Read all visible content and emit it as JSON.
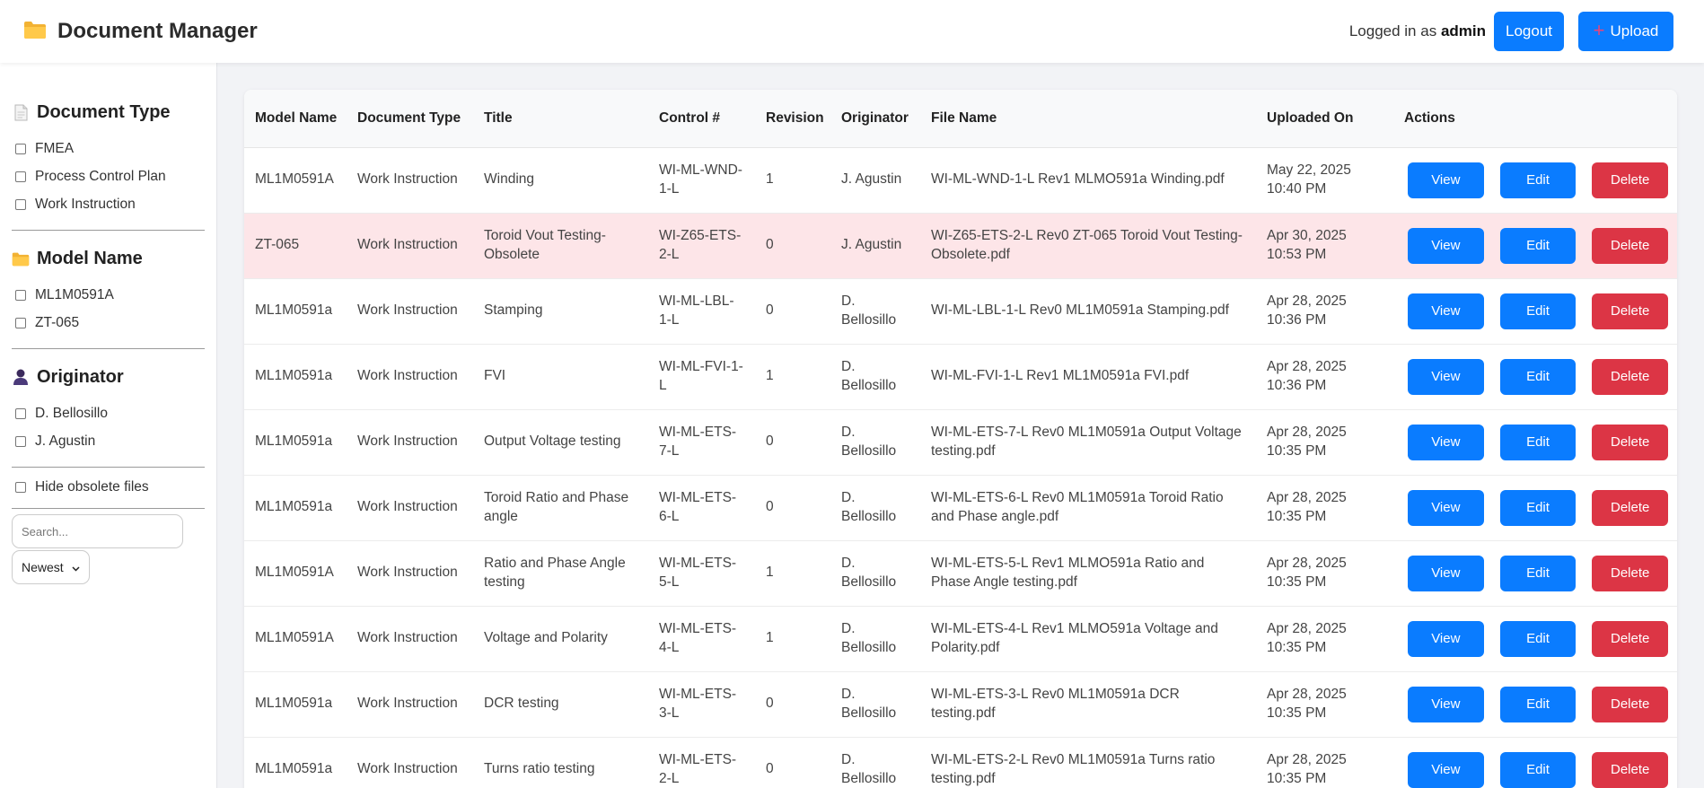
{
  "header": {
    "title": "Document Manager",
    "logged_prefix": "Logged in as",
    "username": "admin",
    "logout_label": "Logout",
    "upload_label": "Upload"
  },
  "sidebar": {
    "document_type": {
      "title": "Document Type",
      "options": [
        "FMEA",
        "Process Control Plan",
        "Work Instruction"
      ]
    },
    "model_name": {
      "title": "Model Name",
      "options": [
        "ML1M0591A",
        "ZT-065"
      ]
    },
    "originator": {
      "title": "Originator",
      "options": [
        "D. Bellosillo",
        "J. Agustin"
      ]
    },
    "hide_obsolete_label": "Hide obsolete files",
    "search_placeholder": "Search...",
    "sort_value": "Newest"
  },
  "table": {
    "headers": [
      "Model Name",
      "Document Type",
      "Title",
      "Control #",
      "Revision",
      "Originator",
      "File Name",
      "Uploaded On",
      "Actions"
    ],
    "action_labels": {
      "view": "View",
      "edit": "Edit",
      "delete": "Delete"
    },
    "rows": [
      {
        "model": "ML1M0591A",
        "type": "Work Instruction",
        "title": "Winding",
        "control": "WI-ML-WND-1-L",
        "revision": "1",
        "originator": "J. Agustin",
        "file": "WI-ML-WND-1-L Rev1 MLMO591a Winding.pdf",
        "uploaded": "May 22, 2025 10:40 PM",
        "obsolete": false
      },
      {
        "model": "ZT-065",
        "type": "Work Instruction",
        "title": "Toroid Vout Testing-Obsolete",
        "control": "WI-Z65-ETS-2-L",
        "revision": "0",
        "originator": "J. Agustin",
        "file": "WI-Z65-ETS-2-L Rev0 ZT-065 Toroid Vout Testing-Obsolete.pdf",
        "uploaded": "Apr 30, 2025 10:53 PM",
        "obsolete": true
      },
      {
        "model": "ML1M0591a",
        "type": "Work Instruction",
        "title": "Stamping",
        "control": "WI-ML-LBL-1-L",
        "revision": "0",
        "originator": "D. Bellosillo",
        "file": "WI-ML-LBL-1-L Rev0 ML1M0591a Stamping.pdf",
        "uploaded": "Apr 28, 2025 10:36 PM",
        "obsolete": false
      },
      {
        "model": "ML1M0591a",
        "type": "Work Instruction",
        "title": "FVI",
        "control": "WI-ML-FVI-1-L",
        "revision": "1",
        "originator": "D. Bellosillo",
        "file": "WI-ML-FVI-1-L Rev1 ML1M0591a FVI.pdf",
        "uploaded": "Apr 28, 2025 10:36 PM",
        "obsolete": false
      },
      {
        "model": "ML1M0591a",
        "type": "Work Instruction",
        "title": "Output Voltage testing",
        "control": "WI-ML-ETS-7-L",
        "revision": "0",
        "originator": "D. Bellosillo",
        "file": "WI-ML-ETS-7-L Rev0 ML1M0591a Output Voltage testing.pdf",
        "uploaded": "Apr 28, 2025 10:35 PM",
        "obsolete": false
      },
      {
        "model": "ML1M0591a",
        "type": "Work Instruction",
        "title": "Toroid Ratio and Phase angle",
        "control": "WI-ML-ETS-6-L",
        "revision": "0",
        "originator": "D. Bellosillo",
        "file": "WI-ML-ETS-6-L Rev0 ML1M0591a Toroid Ratio and Phase angle.pdf",
        "uploaded": "Apr 28, 2025 10:35 PM",
        "obsolete": false
      },
      {
        "model": "ML1M0591A",
        "type": "Work Instruction",
        "title": "Ratio and Phase Angle testing",
        "control": "WI-ML-ETS-5-L",
        "revision": "1",
        "originator": "D. Bellosillo",
        "file": "WI-ML-ETS-5-L Rev1 MLMO591a Ratio and Phase Angle testing.pdf",
        "uploaded": "Apr 28, 2025 10:35 PM",
        "obsolete": false
      },
      {
        "model": "ML1M0591A",
        "type": "Work Instruction",
        "title": "Voltage and Polarity",
        "control": "WI-ML-ETS-4-L",
        "revision": "1",
        "originator": "D. Bellosillo",
        "file": "WI-ML-ETS-4-L Rev1 MLMO591a Voltage and Polarity.pdf",
        "uploaded": "Apr 28, 2025 10:35 PM",
        "obsolete": false
      },
      {
        "model": "ML1M0591a",
        "type": "Work Instruction",
        "title": "DCR testing",
        "control": "WI-ML-ETS-3-L",
        "revision": "0",
        "originator": "D. Bellosillo",
        "file": "WI-ML-ETS-3-L Rev0 ML1M0591a DCR testing.pdf",
        "uploaded": "Apr 28, 2025 10:35 PM",
        "obsolete": false
      },
      {
        "model": "ML1M0591a",
        "type": "Work Instruction",
        "title": "Turns ratio testing",
        "control": "WI-ML-ETS-2-L",
        "revision": "0",
        "originator": "D. Bellosillo",
        "file": "WI-ML-ETS-2-L Rev0 ML1M0591a Turns ratio testing.pdf",
        "uploaded": "Apr 28, 2025 10:35 PM",
        "obsolete": false
      }
    ]
  },
  "colors": {
    "primary": "#0a7cff",
    "danger": "#dc3545",
    "obsolete_row": "#fde5e8"
  },
  "icons": {
    "brand": "folder-icon",
    "doc_type": "document-icon",
    "model": "folder-icon",
    "originator": "person-icon",
    "upload": "plus-icon"
  }
}
